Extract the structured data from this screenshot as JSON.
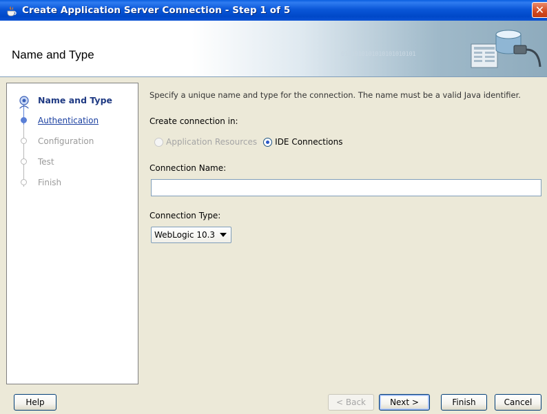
{
  "window": {
    "title": "Create Application Server Connection - Step 1 of 5",
    "close_glyph": "✕"
  },
  "header": {
    "title": "Name and Type",
    "decoration_text": "0101010101010101010101"
  },
  "nav": {
    "items": [
      {
        "label": "Name and Type",
        "state": "active"
      },
      {
        "label": "Authentication",
        "state": "link"
      },
      {
        "label": "Configuration",
        "state": "disabled"
      },
      {
        "label": "Test",
        "state": "disabled"
      },
      {
        "label": "Finish",
        "state": "disabled"
      }
    ]
  },
  "main": {
    "description": "Specify a unique name and type for the connection. The name must be a valid Java identifier.",
    "create_in_label": "Create connection in:",
    "radio_app_resources": "Application Resources",
    "radio_ide_connections": "IDE Connections",
    "selected_radio": "IDE Connections",
    "connection_name_label": "Connection Name:",
    "connection_name_value": "",
    "connection_type_label": "Connection Type:",
    "connection_type_value": "WebLogic 10.3"
  },
  "buttons": {
    "help": "Help",
    "back": "< Back",
    "next": "Next >",
    "finish": "Finish",
    "cancel": "Cancel"
  },
  "colors": {
    "titlebar": "#0a57d8",
    "nav_active": "#1f3a83",
    "nav_link": "#1a3fa0",
    "disabled_text": "#9a9a9a"
  }
}
